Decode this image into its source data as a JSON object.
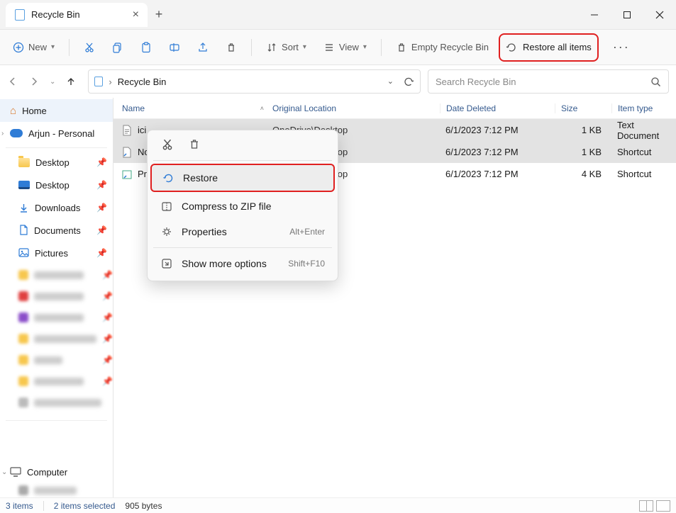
{
  "titlebar": {
    "tab_label": "Recycle Bin"
  },
  "toolbar": {
    "new": "New",
    "sort": "Sort",
    "view": "View",
    "empty": "Empty Recycle Bin",
    "restore_all": "Restore all items"
  },
  "addressbar": {
    "location": "Recycle Bin"
  },
  "search": {
    "placeholder": "Search Recycle Bin"
  },
  "sidebar": {
    "home": "Home",
    "personal": "Arjun - Personal",
    "quick": {
      "desktop1": "Desktop",
      "desktop2": "Desktop",
      "downloads": "Downloads",
      "documents": "Documents",
      "pictures": "Pictures"
    },
    "computer": "Computer"
  },
  "columns": {
    "name": "Name",
    "orig": "Original Location",
    "date": "Date Deleted",
    "size": "Size",
    "type": "Item type"
  },
  "rows": [
    {
      "name_prefix": "ici",
      "orig_suffix": "OneDrive\\Desktop",
      "date": "6/1/2023 7:12 PM",
      "size": "1 KB",
      "type": "Text Document"
    },
    {
      "name_prefix": "No",
      "orig_suffix": "OneDrive\\Desktop",
      "date": "6/1/2023 7:12 PM",
      "size": "1 KB",
      "type": "Shortcut"
    },
    {
      "name_prefix": "Pr",
      "orig_suffix": "OneDrive\\Desktop",
      "date": "6/1/2023 7:12 PM",
      "size": "4 KB",
      "type": "Shortcut"
    }
  ],
  "context_menu": {
    "restore": "Restore",
    "compress": "Compress to ZIP file",
    "properties": "Properties",
    "properties_sc": "Alt+Enter",
    "show_more": "Show more options",
    "show_more_sc": "Shift+F10"
  },
  "statusbar": {
    "count": "3 items",
    "selected": "2 items selected",
    "bytes": "905 bytes"
  }
}
